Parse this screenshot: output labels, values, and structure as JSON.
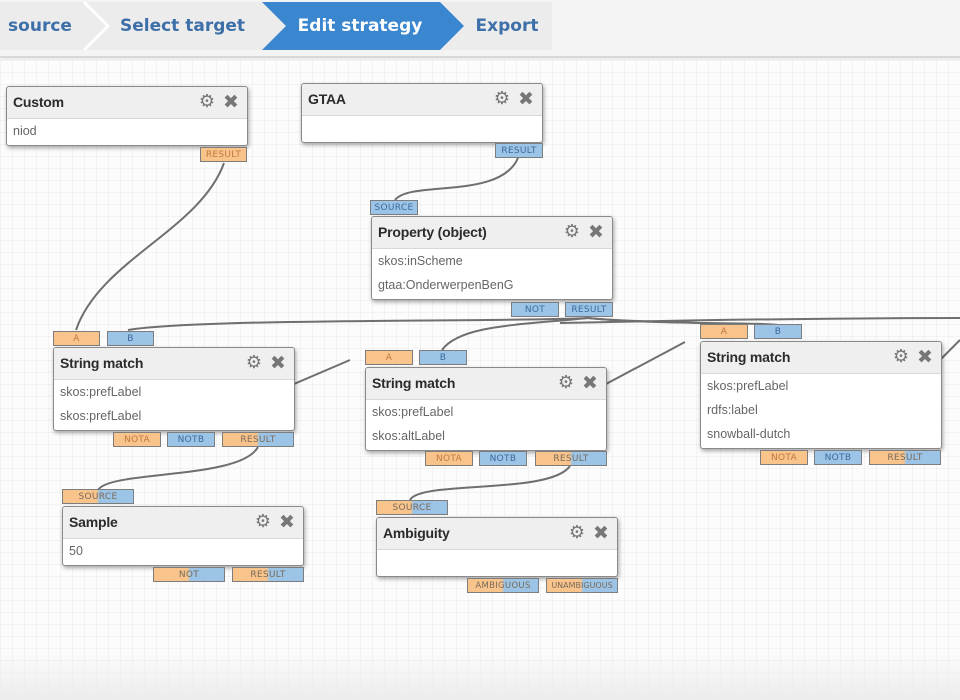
{
  "wizard": {
    "steps": [
      {
        "label": "source",
        "state": "done"
      },
      {
        "label": "Select target",
        "state": "done"
      },
      {
        "label": "Edit strategy",
        "state": "active"
      },
      {
        "label": "Export",
        "state": "pending"
      }
    ],
    "colors": {
      "active": "#3a87d0",
      "text": "#3d6fa8",
      "inactive_bg": "#ececec"
    }
  },
  "port_colors": {
    "input_a": "#f8c48c",
    "input_b": "#9cc4e6"
  },
  "nodes": {
    "custom": {
      "title": "Custom",
      "rows": [
        "niod"
      ],
      "ports": {
        "result": "RESULT"
      }
    },
    "gtaa": {
      "title": "GTAA",
      "rows": [],
      "ports": {
        "result": "RESULT"
      }
    },
    "property": {
      "title": "Property (object)",
      "rows": [
        "skos:inScheme",
        "gtaa:OnderwerpenBenG"
      ],
      "ports": {
        "source": "SOURCE",
        "not": "NOT",
        "result": "RESULT"
      }
    },
    "string_match_1": {
      "title": "String match",
      "rows": [
        "skos:prefLabel",
        "skos:prefLabel"
      ],
      "ports": {
        "a": "A",
        "b": "B",
        "nota": "NOTA",
        "notb": "NOTB",
        "result": "RESULT"
      }
    },
    "string_match_2": {
      "title": "String match",
      "rows": [
        "skos:prefLabel",
        "skos:altLabel"
      ],
      "ports": {
        "a": "A",
        "b": "B",
        "nota": "NOTA",
        "notb": "NOTB",
        "result": "RESULT"
      }
    },
    "string_match_3": {
      "title": "String match",
      "rows": [
        "skos:prefLabel",
        "rdfs:label",
        "snowball-dutch"
      ],
      "ports": {
        "a": "A",
        "b": "B",
        "nota": "NOTA",
        "notb": "NOTB",
        "result": "RESULT"
      }
    },
    "sample": {
      "title": "Sample",
      "rows": [
        "50"
      ],
      "ports": {
        "source": "SOURCE",
        "not": "NOT",
        "result": "RESULT"
      }
    },
    "ambiguity": {
      "title": "Ambiguity",
      "rows": [],
      "ports": {
        "source": "SOURCE",
        "ambiguous": "AMBIGUOUS",
        "unambiguous": "UNAMBIGUOUS"
      }
    }
  },
  "icons": {
    "gear": "⚙",
    "close": "✖"
  }
}
